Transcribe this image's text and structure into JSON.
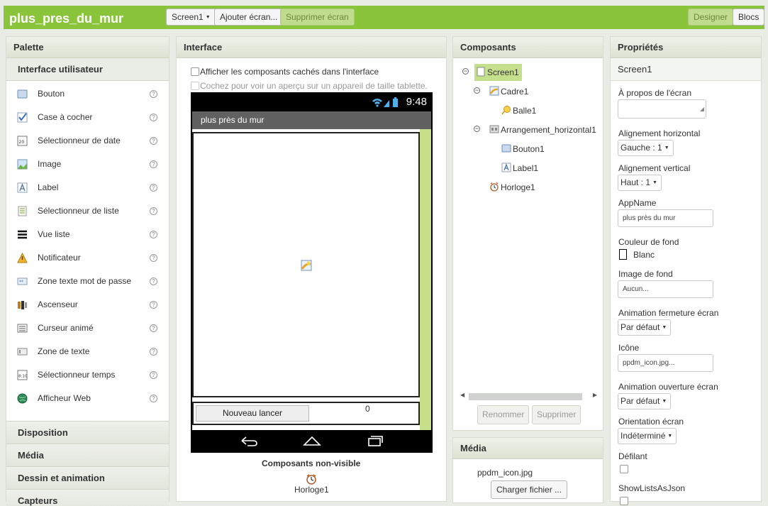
{
  "topbar": {
    "title": "plus_pres_du_mur",
    "screen_select": "Screen1",
    "add_screen": "Ajouter écran...",
    "remove_screen": "Supprimer écran",
    "designer": "Designer",
    "blocks": "Blocs"
  },
  "palette": {
    "header": "Palette",
    "open_category": "Interface utilisateur",
    "items": [
      {
        "label": "Bouton",
        "icon": "button-icon"
      },
      {
        "label": "Case à cocher",
        "icon": "checkbox-icon"
      },
      {
        "label": "Sélectionneur de date",
        "icon": "datepicker-icon"
      },
      {
        "label": "Image",
        "icon": "image-icon"
      },
      {
        "label": "Label",
        "icon": "label-icon"
      },
      {
        "label": "Sélectionneur de liste",
        "icon": "listpicker-icon"
      },
      {
        "label": "Vue liste",
        "icon": "listview-icon"
      },
      {
        "label": "Notificateur",
        "icon": "notifier-icon"
      },
      {
        "label": "Zone texte mot de passe",
        "icon": "password-icon"
      },
      {
        "label": "Ascenseur",
        "icon": "slider-icon"
      },
      {
        "label": "Curseur animé",
        "icon": "spinner-icon"
      },
      {
        "label": "Zone de texte",
        "icon": "textbox-icon"
      },
      {
        "label": "Sélectionneur temps",
        "icon": "timepicker-icon"
      },
      {
        "label": "Afficheur Web",
        "icon": "webviewer-icon"
      }
    ],
    "help_glyph": "?",
    "categories": [
      "Disposition",
      "Média",
      "Dessin et animation",
      "Capteurs"
    ]
  },
  "interface": {
    "header": "Interface",
    "show_hidden": "Afficher les composants cachés dans l'interface",
    "tablet_preview": "Cochez pour voir un aperçu sur un appareil de taille tablette.",
    "time": "9:48",
    "app_title": "plus près du mur",
    "button_text": "Nouveau lancer",
    "label_text": "0",
    "nonvisible_title": "Composants non-visible",
    "nonvisible_item": "Horloge1"
  },
  "components": {
    "header": "Composants",
    "tree": {
      "screen": "Screen1",
      "canvas": "Cadre1",
      "ball": "Balle1",
      "arrangement": "Arrangement_horizontal1",
      "button": "Bouton1",
      "label": "Label1",
      "clock": "Horloge1"
    },
    "collapse_glyph": "−",
    "rename": "Renommer",
    "delete": "Supprimer"
  },
  "media": {
    "header": "Média",
    "file": "ppdm_icon.jpg",
    "upload": "Charger fichier ..."
  },
  "properties": {
    "header": "Propriétés",
    "selected": "Screen1",
    "about_label": "À propos de l'écran",
    "halign_label": "Alignement horizontal",
    "halign_value": "Gauche : 1",
    "valign_label": "Alignement vertical",
    "valign_value": "Haut : 1",
    "appname_label": "AppName",
    "appname_value": "plus près du mur",
    "bgcolor_label": "Couleur de fond",
    "bgcolor_value": "Blanc",
    "bgimage_label": "Image de fond",
    "bgimage_value": "Aucun...",
    "close_anim_label": "Animation fermeture écran",
    "close_anim_value": "Par défaut",
    "icon_label": "Icône",
    "icon_value": "ppdm_icon.jpg...",
    "open_anim_label": "Animation ouverture écran",
    "open_anim_value": "Par défaut",
    "orientation_label": "Orientation écran",
    "orientation_value": "Indéterminé",
    "scrollable_label": "Défilant",
    "showlists_label": "ShowListsAsJson"
  },
  "colors": {
    "accent": "#89c43a",
    "selection": "#c5e08c"
  }
}
